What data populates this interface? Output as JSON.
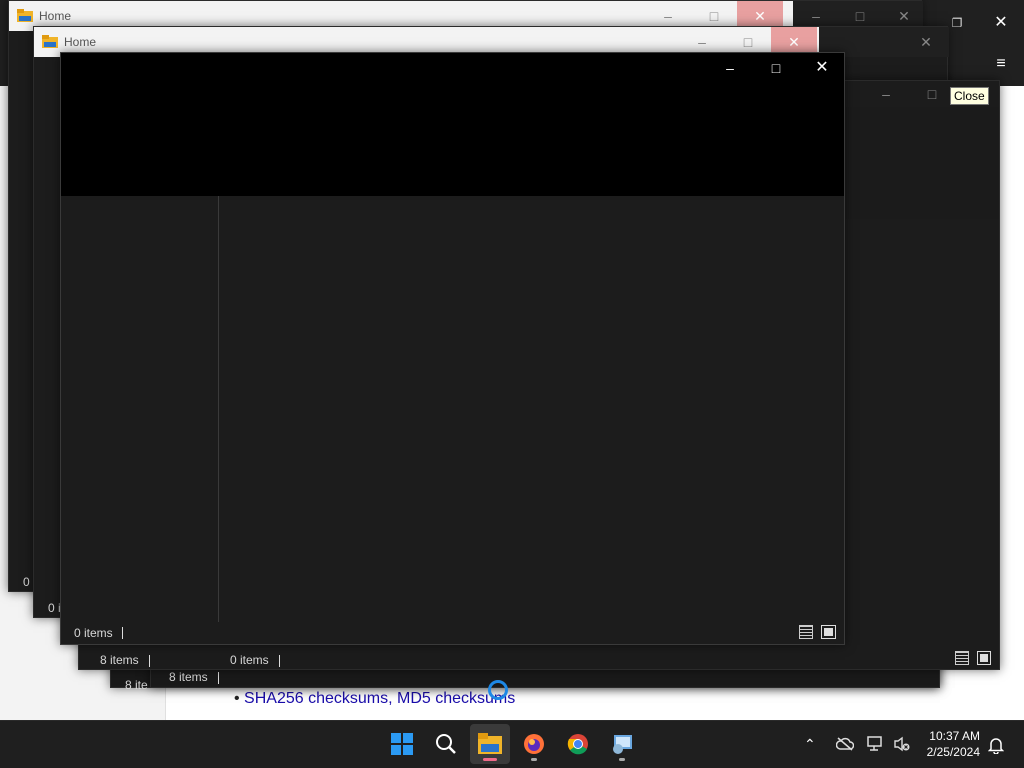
{
  "background_page": {
    "bullet_text": "SHA256 checksums, MD5 checksums"
  },
  "windows": [
    {
      "id": "w1",
      "title": "Home",
      "status": "0 i",
      "status_full": "8 items"
    },
    {
      "id": "w2",
      "title": "Home",
      "status": "0 i",
      "status_full": "8 items"
    },
    {
      "id": "w3",
      "status": "0 items"
    },
    {
      "id": "w4",
      "status": "8 items"
    }
  ],
  "behind_windows": {
    "status_a": "8 items",
    "status_b": "0 items",
    "status_c": "8 items",
    "status_d": "8 ite"
  },
  "active_window": {
    "title": "",
    "status": "0 items"
  },
  "tooltip": "Close",
  "taskbar": {
    "apps": [
      {
        "name": "start",
        "label": "Start"
      },
      {
        "name": "search",
        "label": "Search"
      },
      {
        "name": "file-explorer",
        "label": "File Explorer",
        "active": true
      },
      {
        "name": "firefox",
        "label": "Firefox"
      },
      {
        "name": "chrome",
        "label": "Google Chrome"
      },
      {
        "name": "control-panel",
        "label": "Control Panel"
      }
    ],
    "time": "10:37 AM",
    "date": "2/25/2024"
  },
  "colors": {
    "accent": "#0078d4",
    "taskbar": "#1f1f1f",
    "window_dark": "#1c1c1c",
    "active_indicator": "#f06a8a"
  }
}
